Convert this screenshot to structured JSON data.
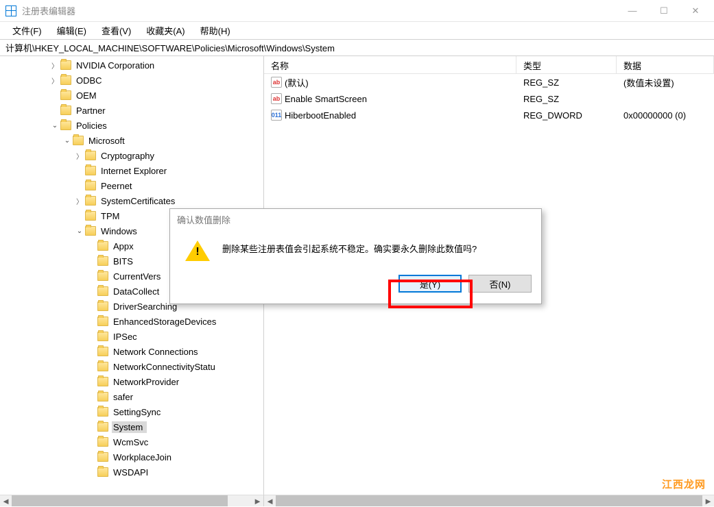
{
  "window": {
    "title": "注册表编辑器",
    "controls": {
      "min": "—",
      "max": "☐",
      "close": "✕"
    }
  },
  "menu": {
    "file": "文件(F)",
    "edit": "编辑(E)",
    "view": "查看(V)",
    "fav": "收藏夹(A)",
    "help": "帮助(H)"
  },
  "address": "计算机\\HKEY_LOCAL_MACHINE\\SOFTWARE\\Policies\\Microsoft\\Windows\\System",
  "tree": [
    {
      "indent": 4,
      "exp": ">",
      "label": "NVIDIA Corporation"
    },
    {
      "indent": 4,
      "exp": ">",
      "label": "ODBC"
    },
    {
      "indent": 4,
      "exp": "",
      "label": "OEM"
    },
    {
      "indent": 4,
      "exp": "",
      "label": "Partner"
    },
    {
      "indent": 4,
      "exp": "v",
      "label": "Policies"
    },
    {
      "indent": 5,
      "exp": "v",
      "label": "Microsoft"
    },
    {
      "indent": 6,
      "exp": ">",
      "label": "Cryptography"
    },
    {
      "indent": 6,
      "exp": "",
      "label": "Internet Explorer"
    },
    {
      "indent": 6,
      "exp": "",
      "label": "Peernet"
    },
    {
      "indent": 6,
      "exp": ">",
      "label": "SystemCertificates"
    },
    {
      "indent": 6,
      "exp": "",
      "label": "TPM"
    },
    {
      "indent": 6,
      "exp": "v",
      "label": "Windows"
    },
    {
      "indent": 7,
      "exp": "",
      "label": "Appx"
    },
    {
      "indent": 7,
      "exp": "",
      "label": "BITS"
    },
    {
      "indent": 7,
      "exp": "",
      "label": "CurrentVers"
    },
    {
      "indent": 7,
      "exp": "",
      "label": "DataCollect"
    },
    {
      "indent": 7,
      "exp": "",
      "label": "DriverSearching"
    },
    {
      "indent": 7,
      "exp": "",
      "label": "EnhancedStorageDevices"
    },
    {
      "indent": 7,
      "exp": "",
      "label": "IPSec"
    },
    {
      "indent": 7,
      "exp": "",
      "label": "Network Connections"
    },
    {
      "indent": 7,
      "exp": "",
      "label": "NetworkConnectivityStatu"
    },
    {
      "indent": 7,
      "exp": "",
      "label": "NetworkProvider"
    },
    {
      "indent": 7,
      "exp": "",
      "label": "safer"
    },
    {
      "indent": 7,
      "exp": "",
      "label": "SettingSync"
    },
    {
      "indent": 7,
      "exp": "",
      "label": "System",
      "selected": true
    },
    {
      "indent": 7,
      "exp": "",
      "label": "WcmSvc"
    },
    {
      "indent": 7,
      "exp": "",
      "label": "WorkplaceJoin"
    },
    {
      "indent": 7,
      "exp": "",
      "label": "WSDAPI"
    }
  ],
  "columns": {
    "name": "名称",
    "type": "类型",
    "data": "数据"
  },
  "values": [
    {
      "icon": "sz",
      "ico": "ab",
      "name": "(默认)",
      "type": "REG_SZ",
      "data": "(数值未设置)"
    },
    {
      "icon": "sz",
      "ico": "ab",
      "name": "Enable SmartScreen",
      "type": "REG_SZ",
      "data": ""
    },
    {
      "icon": "dw",
      "ico": "011",
      "name": "HiberbootEnabled",
      "type": "REG_DWORD",
      "data": "0x00000000 (0)"
    }
  ],
  "dialog": {
    "title": "确认数值删除",
    "message": "删除某些注册表值会引起系统不稳定。确实要永久删除此数值吗?",
    "yes": "是(Y)",
    "no": "否(N)"
  },
  "watermark": "江西龙网"
}
